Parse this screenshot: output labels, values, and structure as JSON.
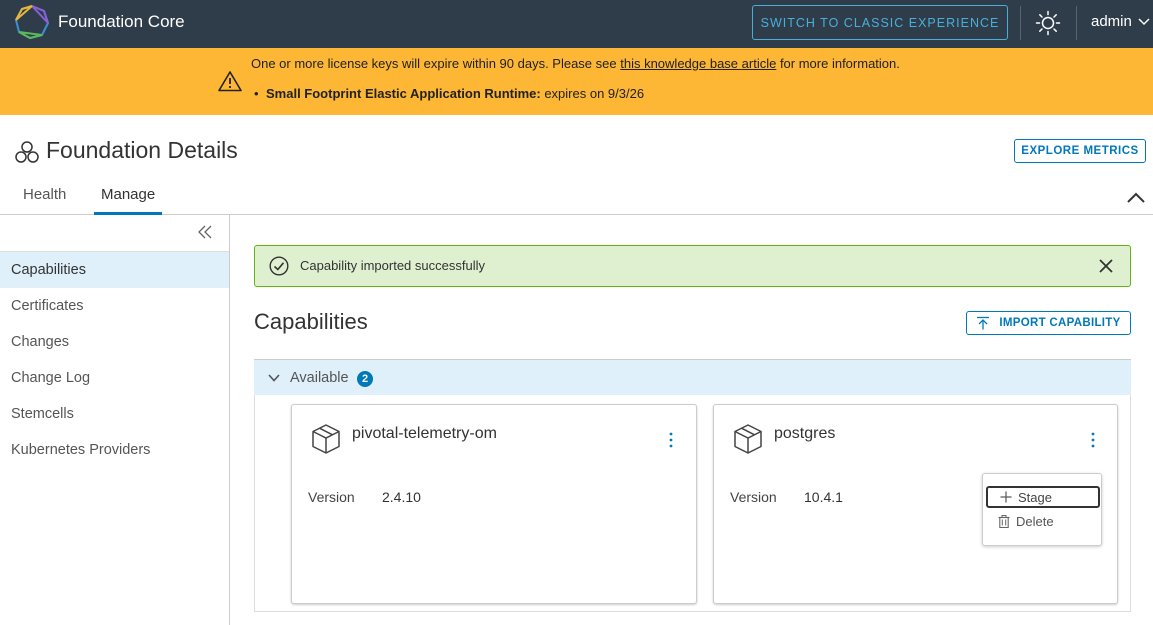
{
  "header": {
    "app_title": "Foundation Core",
    "classic_button": "SWITCH TO CLASSIC EXPERIENCE",
    "user": "admin",
    "header_bg": "#2f3d4a"
  },
  "banner": {
    "text_before": "One or more license keys will expire within 90 days. Please see ",
    "link_text": "this knowledge base article",
    "text_after": " for more information.",
    "item_bold": "Small Footprint Elastic Application Runtime:",
    "item_rest": " expires on 9/3/26",
    "color": "#fdb734"
  },
  "page": {
    "title": "Foundation Details",
    "explore_button": "EXPLORE METRICS",
    "tabs": [
      {
        "label": "Health",
        "active": false
      },
      {
        "label": "Manage",
        "active": true
      }
    ]
  },
  "sidebar": {
    "items": [
      {
        "label": "Capabilities",
        "active": true
      },
      {
        "label": "Certificates",
        "active": false
      },
      {
        "label": "Changes",
        "active": false
      },
      {
        "label": "Change Log",
        "active": false
      },
      {
        "label": "Stemcells",
        "active": false
      },
      {
        "label": "Kubernetes Providers",
        "active": false
      }
    ]
  },
  "alert": {
    "message": "Capability imported successfully"
  },
  "main": {
    "section_title": "Capabilities",
    "import_button": "IMPORT CAPABILITY",
    "available_label": "Available",
    "available_count": "2",
    "version_label": "Version",
    "cards": [
      {
        "name": "pivotal-telemetry-om",
        "version": "2.4.10"
      },
      {
        "name": "postgres",
        "version": "10.4.1"
      }
    ],
    "menu": {
      "stage": "Stage",
      "delete": "Delete"
    }
  },
  "colors": {
    "accent": "#0079b8",
    "success_bg": "#dff0d0",
    "success_border": "#60b515",
    "selected_bg": "#dff0fb"
  }
}
